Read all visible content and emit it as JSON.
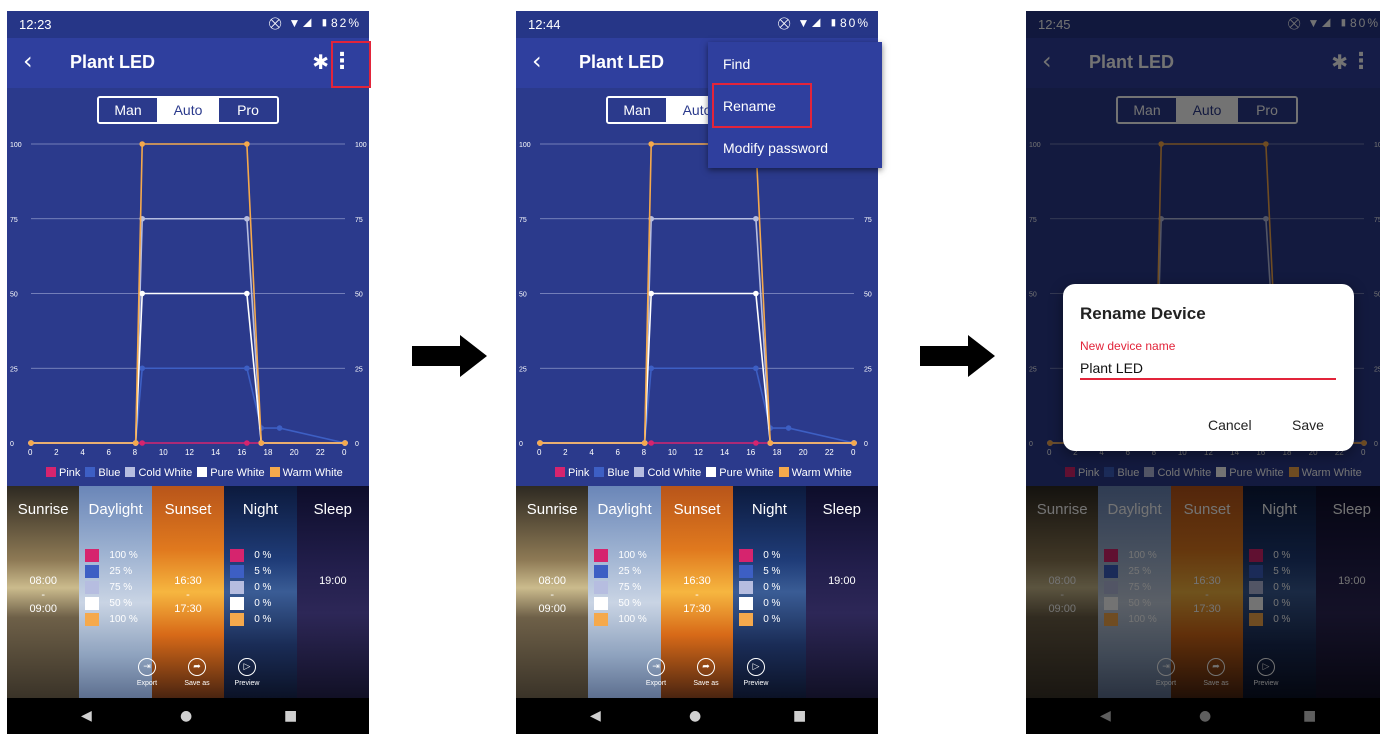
{
  "status": [
    {
      "time": "12:23",
      "battery": "82%",
      "icons": "⛒ ▼◢ ▮"
    },
    {
      "time": "12:44",
      "battery": "80%",
      "icons": "⛒ ▼◢ ▮"
    },
    {
      "time": "12:45",
      "battery": "80%",
      "icons": "⛒ ▼◢ ▮"
    }
  ],
  "app": {
    "title": "Plant LED",
    "back_icon": "‹",
    "bluetooth_icon": "✱",
    "more_icon": "⋮"
  },
  "modes": [
    "Man",
    "Auto",
    "Pro"
  ],
  "active_mode": "Auto",
  "chart_data": {
    "type": "line",
    "x_ticks": [
      "0",
      "2",
      "4",
      "6",
      "8",
      "10",
      "12",
      "14",
      "16",
      "18",
      "20",
      "22",
      "0"
    ],
    "y_ticks": [
      "0",
      "25",
      "50",
      "75",
      "100"
    ],
    "ylim": [
      0,
      100
    ],
    "series": [
      {
        "name": "Pink",
        "color": "#d6246e",
        "x": [
          0,
          8,
          8.5,
          16.5,
          17.6,
          24
        ],
        "values": [
          0,
          0,
          0,
          0,
          0,
          0
        ]
      },
      {
        "name": "Blue",
        "color": "#3d5fc4",
        "x": [
          0,
          8,
          8.5,
          16.5,
          17.6,
          19,
          24
        ],
        "values": [
          0,
          0,
          25,
          25,
          5,
          5,
          0
        ]
      },
      {
        "name": "Cold White",
        "color": "#b6bde0",
        "x": [
          0,
          8,
          8.5,
          16.5,
          17.6,
          24
        ],
        "values": [
          0,
          0,
          75,
          75,
          0,
          0
        ]
      },
      {
        "name": "Pure White",
        "color": "#ffffff",
        "x": [
          0,
          8,
          8.5,
          16.5,
          17.6,
          24
        ],
        "values": [
          0,
          0,
          50,
          50,
          0,
          0
        ]
      },
      {
        "name": "Warm White",
        "color": "#f5a94c",
        "x": [
          0,
          8,
          8.5,
          16.5,
          17.6,
          24
        ],
        "values": [
          0,
          0,
          100,
          100,
          0,
          0
        ]
      }
    ]
  },
  "legend": [
    {
      "label": "Pink",
      "color": "#d6246e"
    },
    {
      "label": "Blue",
      "color": "#3d5fc4"
    },
    {
      "label": "Cold White",
      "color": "#b6bde0"
    },
    {
      "label": "Pure White",
      "color": "#ffffff"
    },
    {
      "label": "Warm White",
      "color": "#f5a94c"
    }
  ],
  "scenes": {
    "sunrise": {
      "name": "Sunrise",
      "start": "08:00",
      "dash": "-",
      "end": "09:00"
    },
    "daylight": {
      "name": "Daylight",
      "values": [
        "100 %",
        "25 %",
        "75 %",
        "50 %",
        "100 %"
      ]
    },
    "sunset": {
      "name": "Sunset",
      "start": "16:30",
      "dash": "-",
      "end": "17:30"
    },
    "night": {
      "name": "Night",
      "values": [
        "0 %",
        "5 %",
        "0 %",
        "0 %",
        "0 %"
      ]
    },
    "sleep": {
      "name": "Sleep",
      "start": "19:00"
    }
  },
  "actions": {
    "export": "Export",
    "save_as": "Save as",
    "preview": "Preview",
    "export_icon": "⇥",
    "save_icon": "➦",
    "preview_icon": "▷"
  },
  "nav": {
    "back": "◀",
    "home": "●",
    "recents": "■"
  },
  "menu": {
    "find": "Find",
    "rename": "Rename",
    "modify": "Modify password"
  },
  "dialog": {
    "title": "Rename Device",
    "label": "New device name",
    "value": "Plant LED",
    "cancel": "Cancel",
    "save": "Save"
  },
  "colors": {
    "accent": "#e2243a",
    "appbar": "#2f3f9e",
    "background": "#2b3a8c"
  }
}
